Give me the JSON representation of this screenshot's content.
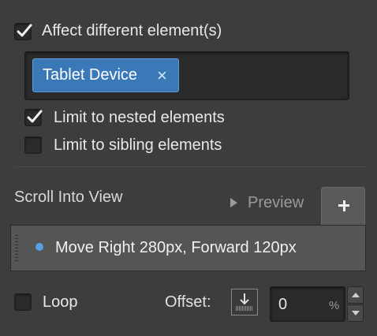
{
  "affect": {
    "label": "Affect different element(s)",
    "checked": true
  },
  "target_tags": [
    {
      "label": "Tablet Device",
      "remove_icon": "close-icon",
      "remove_glyph": "×"
    }
  ],
  "limit_nested": {
    "label": "Limit to nested elements",
    "checked": true
  },
  "limit_sibling": {
    "label": "Limit to sibling elements",
    "checked": false
  },
  "trigger": {
    "title": "Scroll Into View",
    "preview_label": "Preview",
    "add_icon": "plus-icon"
  },
  "actions": [
    {
      "text": "Move Right 280px, Forward 120px",
      "color": "#5aa0e6"
    }
  ],
  "loop": {
    "label": "Loop",
    "checked": false
  },
  "offset": {
    "label": "Offset:",
    "value": "0",
    "unit": "%",
    "icon": "anchor-bottom-icon"
  },
  "colors": {
    "background": "#3d3d3d",
    "accent": "#3a78b8",
    "panel": "#555555"
  }
}
